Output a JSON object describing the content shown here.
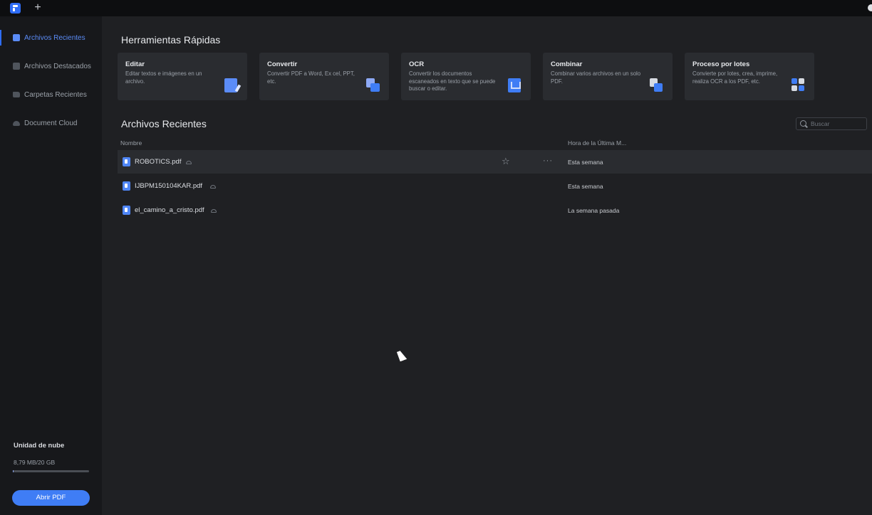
{
  "titlebar": {
    "new_tab": "+"
  },
  "sidebar": {
    "items": [
      {
        "label": "Archivos Recientes",
        "icon": "recent-files-icon",
        "active": true
      },
      {
        "label": "Archivos Destacados",
        "icon": "starred-files-icon",
        "active": false
      },
      {
        "label": "Carpetas Recientes",
        "icon": "folder-icon",
        "active": false
      },
      {
        "label": "Document Cloud",
        "icon": "cloud-icon",
        "active": false
      }
    ],
    "cloud": {
      "title": "Unidad de nube",
      "usage": "8,79 MB/20 GB",
      "usage_fraction": 0.0004
    },
    "open_button": "Abrir PDF"
  },
  "quick_tools": {
    "title": "Herramientas Rápidas",
    "cards": [
      {
        "title": "Editar",
        "desc": "Editar textos e imágenes en un archivo.",
        "icon": "edit-icon"
      },
      {
        "title": "Convertir",
        "desc": "Convertir PDF a Word, Ex cel, PPT, etc.",
        "icon": "convert-icon"
      },
      {
        "title": "OCR",
        "desc": "Convertir los documentos escaneados en texto que se puede buscar o editar.",
        "icon": "ocr-icon"
      },
      {
        "title": "Combinar",
        "desc": "Combinar varios archivos en un solo PDF.",
        "icon": "combine-icon"
      },
      {
        "title": "Proceso por lotes",
        "desc": "Convierte por lotes, crea, imprime, realiza OCR a los PDF, etc.",
        "icon": "batch-icon"
      }
    ]
  },
  "recent": {
    "title": "Archivos Recientes",
    "search_placeholder": "Buscar",
    "columns": {
      "name": "Nombre",
      "time": "Hora de la Última M..."
    },
    "files": [
      {
        "name": "ROBOTICS.pdf",
        "time": "Esta semana"
      },
      {
        "name": "IJBPM150104KAR.pdf",
        "time": "Esta semana"
      },
      {
        "name": "el_camino_a_cristo.pdf",
        "time": "La semana pasada"
      }
    ]
  },
  "colors": {
    "accent": "#2f6df6",
    "background": "#1f2023",
    "sidebar": "#17181b",
    "card": "#2a2c30"
  }
}
